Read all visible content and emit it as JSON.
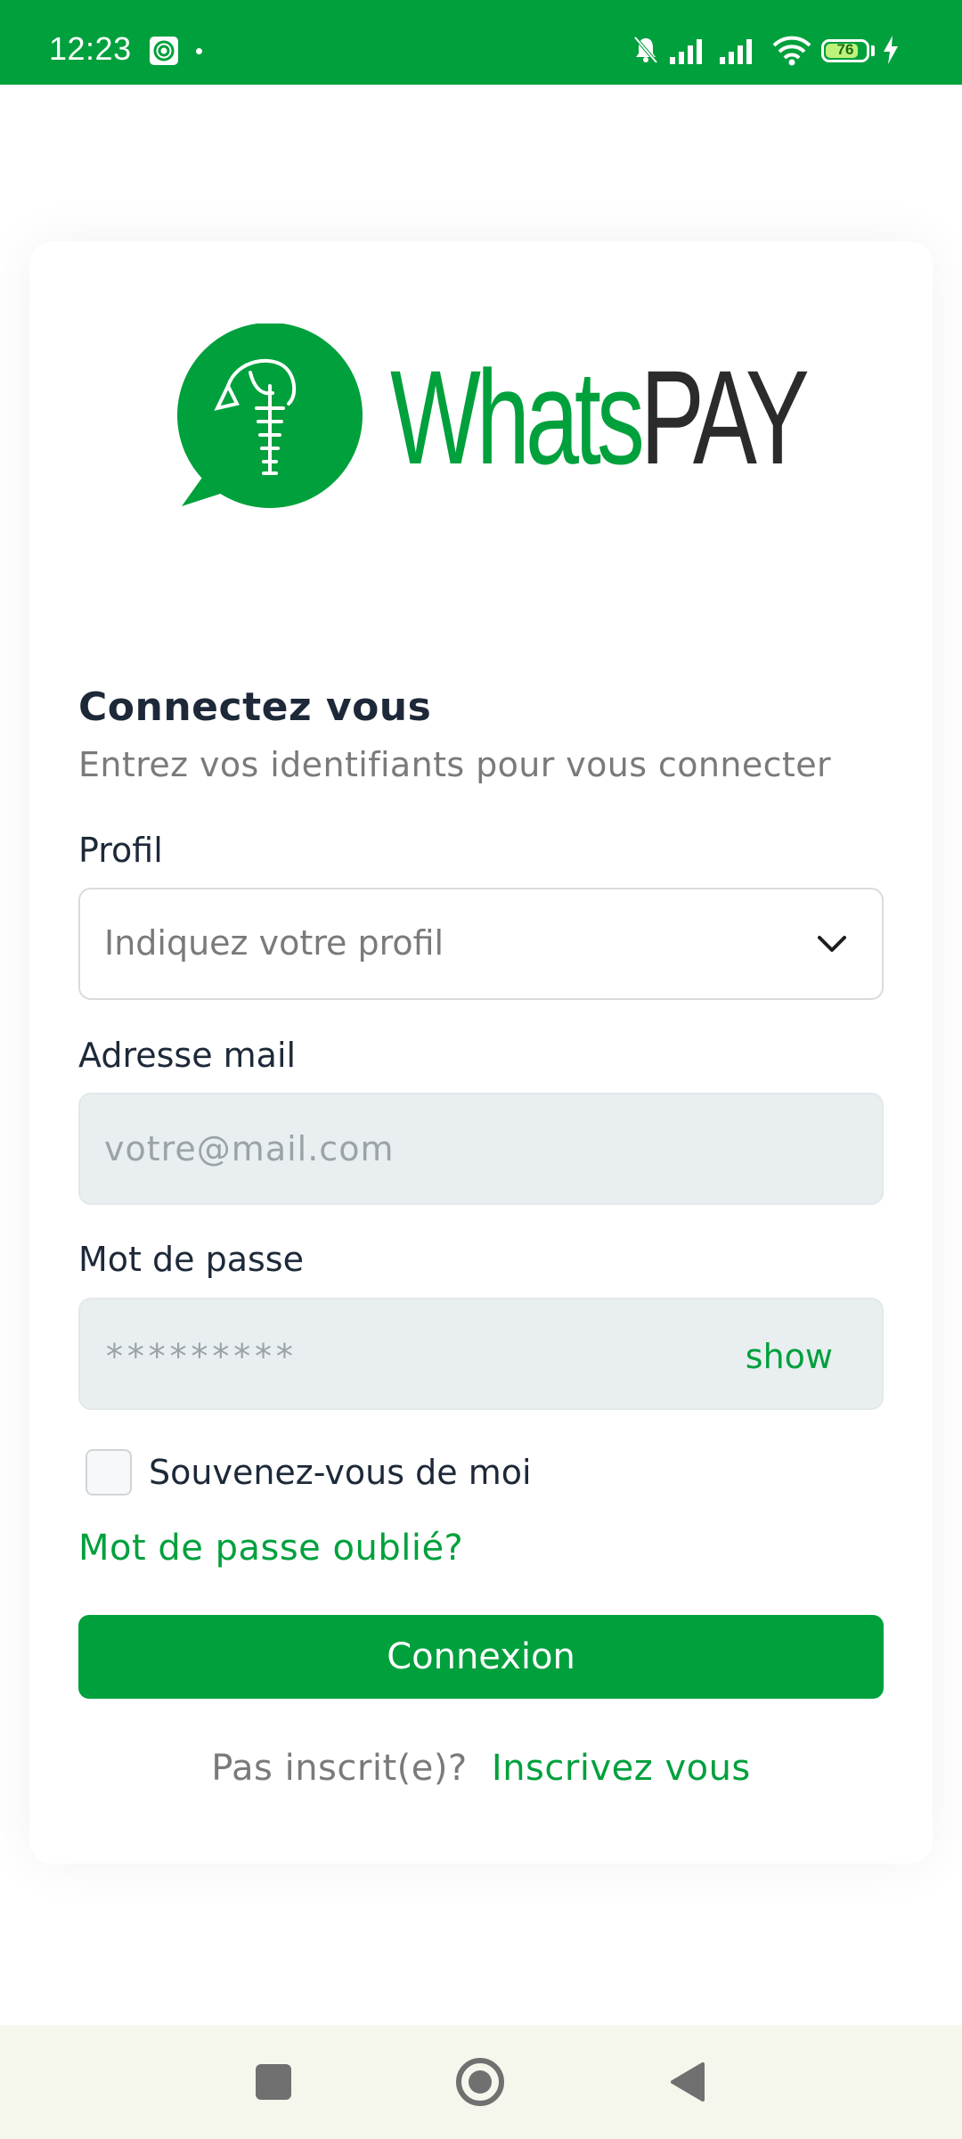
{
  "status_bar": {
    "time": "12:23",
    "battery_level": "76",
    "icons": [
      "app-notification-icon",
      "muted-bell-icon",
      "signal-icon",
      "signal-icon",
      "wifi-icon",
      "battery-icon",
      "charging-icon"
    ]
  },
  "logo": {
    "text_green": "Whats",
    "text_dark": "PAY"
  },
  "login": {
    "title": "Connectez vous",
    "subtitle": "Entrez vos identifiants pour vous connecter",
    "profile_label": "Profil",
    "profile_placeholder": "Indiquez votre profil",
    "email_label": "Adresse mail",
    "email_placeholder": "votre@mail.com",
    "password_label": "Mot de passe",
    "password_mask": "*********",
    "show_label": "show",
    "remember_label": "Souvenez-vous de moi",
    "forgot_label": "Mot de passe oublié?",
    "submit_label": "Connexion",
    "signup_question": "Pas inscrit(e)?",
    "signup_link": "Inscrivez vous"
  },
  "colors": {
    "brand_green": "#00a03c",
    "dark_text": "#1d2939",
    "input_bg": "#e9eef0"
  }
}
